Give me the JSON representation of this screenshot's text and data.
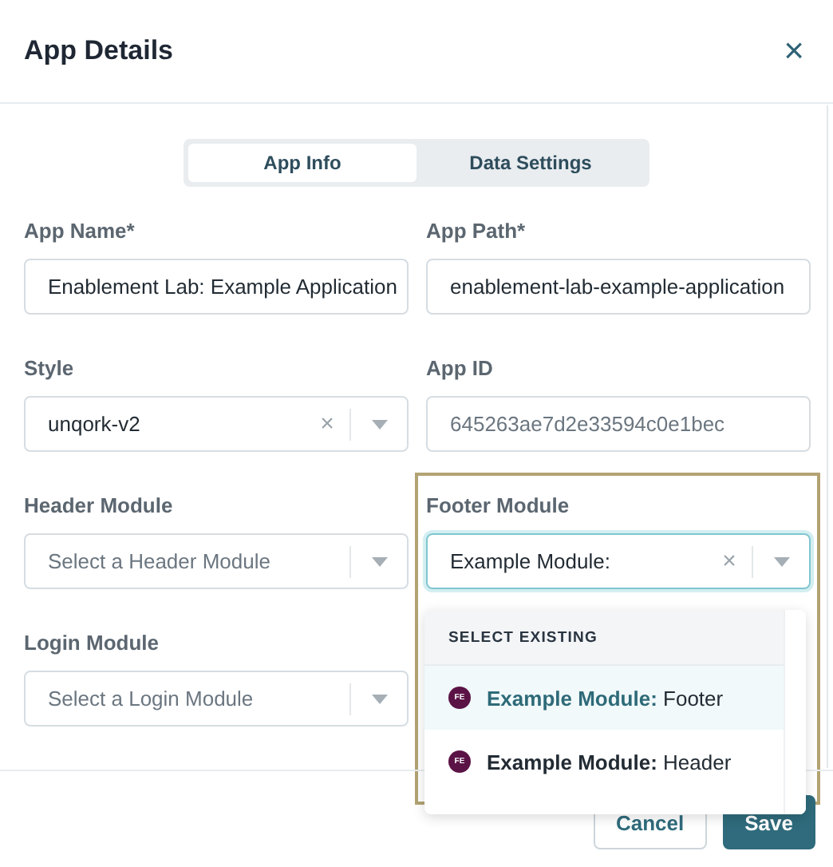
{
  "dialog": {
    "title": "App Details",
    "close": "×"
  },
  "tabs": [
    {
      "label": "App Info",
      "selected": true
    },
    {
      "label": "Data Settings",
      "selected": false
    }
  ],
  "fields": [
    {
      "kind": "text",
      "label": "App Name*",
      "value": "Enablement Lab: Example Application"
    },
    {
      "kind": "text",
      "label": "App Path*",
      "value": "enablement-lab-example-application"
    },
    {
      "kind": "select",
      "label": "Style",
      "value": "unqork-v2",
      "clear": "×"
    },
    {
      "kind": "readonly",
      "label": "App ID",
      "value": "645263ae7d2e33594c0e1bec"
    },
    {
      "kind": "select",
      "label": "Header Module",
      "placeholder": "Select a Header Module"
    },
    {
      "kind": "select",
      "label": "Footer Module",
      "value": "Example Module:",
      "clear": "×",
      "focused": true,
      "highlighted": true
    },
    {
      "kind": "select",
      "label": "Login Module",
      "placeholder": "Select a Login Module"
    }
  ],
  "dropdown": {
    "heading": "SELECT EXISTING",
    "options": [
      {
        "badge": "FE",
        "text": "**Example Module:** Footer",
        "selected": true
      },
      {
        "badge": "FE",
        "text": "**Example Module:** Header",
        "selected": false
      }
    ]
  },
  "buttons": [
    {
      "kind": "secondary",
      "label": "Cancel"
    },
    {
      "kind": "primary",
      "label": "Save"
    }
  ]
}
